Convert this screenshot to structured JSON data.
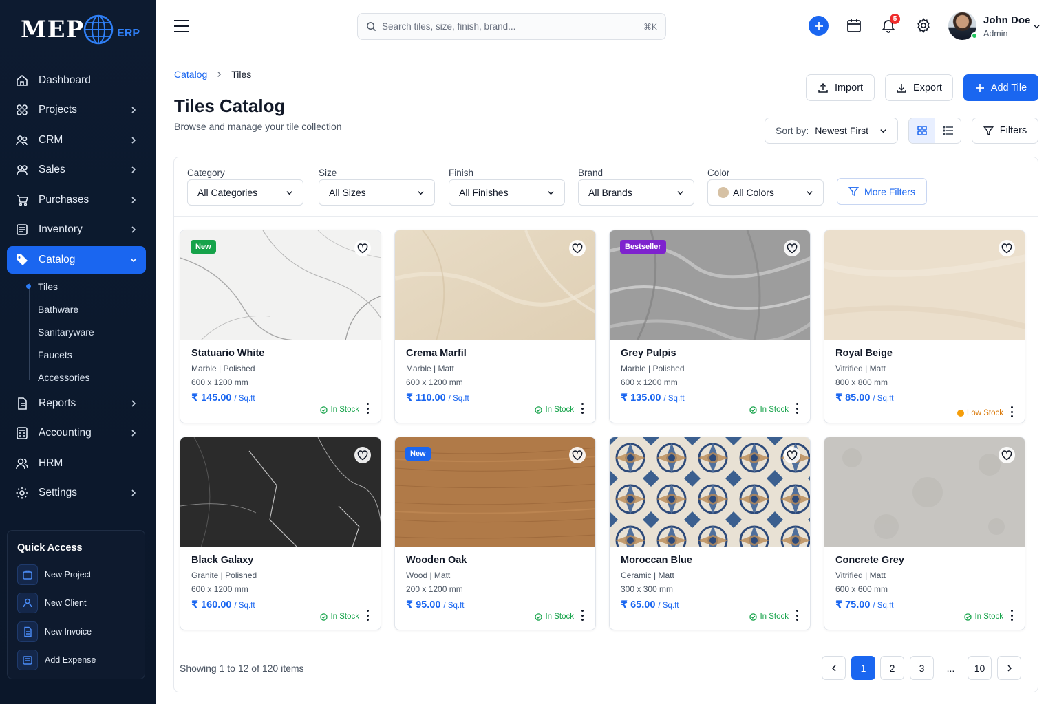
{
  "brand": {
    "logo": "MEP",
    "suffix": "ERP"
  },
  "sidebar": {
    "items": [
      {
        "label": "Dashboard",
        "icon": "home-icon"
      },
      {
        "label": "Projects",
        "icon": "projects-icon"
      },
      {
        "label": "CRM",
        "icon": "crm-icon"
      },
      {
        "label": "Sales",
        "icon": "sales-icon"
      },
      {
        "label": "Purchases",
        "icon": "cart-icon"
      },
      {
        "label": "Inventory",
        "icon": "inventory-icon"
      },
      {
        "label": "Catalog",
        "icon": "tag-icon"
      },
      {
        "label": "Reports",
        "icon": "report-icon"
      },
      {
        "label": "Accounting",
        "icon": "accounting-icon"
      },
      {
        "label": "HRM",
        "icon": "users-icon"
      },
      {
        "label": "Settings",
        "icon": "gear-icon"
      }
    ],
    "catalog_sub": [
      "Tiles",
      "Bathware",
      "Sanitaryware",
      "Faucets",
      "Accessories"
    ],
    "quick_access": {
      "title": "Quick Access",
      "items": [
        "New Project",
        "New Client",
        "New Invoice",
        "Add Expense"
      ]
    }
  },
  "topbar": {
    "search_placeholder": "Search tiles, size, finish, brand...",
    "shortcut": "⌘K",
    "notification_count": "5",
    "user": {
      "name": "John Doe",
      "role": "Admin"
    }
  },
  "page": {
    "breadcrumb": [
      "Catalog",
      "Tiles"
    ],
    "title": "Tiles Catalog",
    "subtitle": "Browse and manage your tile collection",
    "actions": {
      "import": "Import",
      "export": "Export",
      "add": "Add Tile"
    },
    "sort": {
      "label": "Sort by:",
      "value": "Newest First"
    },
    "filters_label": "Filters"
  },
  "filters": {
    "category": {
      "label": "Category",
      "value": "All Categories"
    },
    "size": {
      "label": "Size",
      "value": "All Sizes"
    },
    "finish": {
      "label": "Finish",
      "value": "All Finishes"
    },
    "brand": {
      "label": "Brand",
      "value": "All Brands"
    },
    "color": {
      "label": "Color",
      "value": "All Colors"
    },
    "more": "More Filters"
  },
  "products": [
    {
      "name": "Statuario White",
      "meta": "Marble | Polished",
      "size": "600 x 1200 mm",
      "price": "₹ 145.00",
      "unit": "/ Sq.ft",
      "stock": "In Stock",
      "tag": "New"
    },
    {
      "name": "Crema Marfil",
      "meta": "Marble | Matt",
      "size": "600 x 1200 mm",
      "price": "₹ 110.00",
      "unit": "/ Sq.ft",
      "stock": "In Stock",
      "tag": ""
    },
    {
      "name": "Grey Pulpis",
      "meta": "Marble | Polished",
      "size": "600 x 1200 mm",
      "price": "₹ 135.00",
      "unit": "/ Sq.ft",
      "stock": "In Stock",
      "tag": "Bestseller"
    },
    {
      "name": "Royal Beige",
      "meta": "Vitrified | Matt",
      "size": "800 x 800 mm",
      "price": "₹ 85.00",
      "unit": "/ Sq.ft",
      "stock": "Low Stock",
      "tag": ""
    },
    {
      "name": "Black Galaxy",
      "meta": "Granite | Polished",
      "size": "600 x 1200 mm",
      "price": "₹ 160.00",
      "unit": "/ Sq.ft",
      "stock": "In Stock",
      "tag": ""
    },
    {
      "name": "Wooden Oak",
      "meta": "Wood | Matt",
      "size": "200 x 1200 mm",
      "price": "₹ 95.00",
      "unit": "/ Sq.ft",
      "stock": "In Stock",
      "tag": "New"
    },
    {
      "name": "Moroccan Blue",
      "meta": "Ceramic | Matt",
      "size": "300 x 300 mm",
      "price": "₹ 65.00",
      "unit": "/ Sq.ft",
      "stock": "In Stock",
      "tag": ""
    },
    {
      "name": "Concrete Grey",
      "meta": "Vitrified | Matt",
      "size": "600 x 600 mm",
      "price": "₹ 75.00",
      "unit": "/ Sq.ft",
      "stock": "In Stock",
      "tag": ""
    }
  ],
  "pagination": {
    "showing": "Showing 1 to 12 of 120 items",
    "pages": [
      "1",
      "2",
      "3",
      "...",
      "10"
    ]
  },
  "colors": {
    "accent": "#1a66f0",
    "sidebar": "#0d1b30",
    "in_stock": "#16a34a",
    "low_stock": "#d97706",
    "tag_new_green": "#16a34a",
    "tag_new_blue": "#1a66f0",
    "tag_bestseller": "#7e22ce"
  }
}
